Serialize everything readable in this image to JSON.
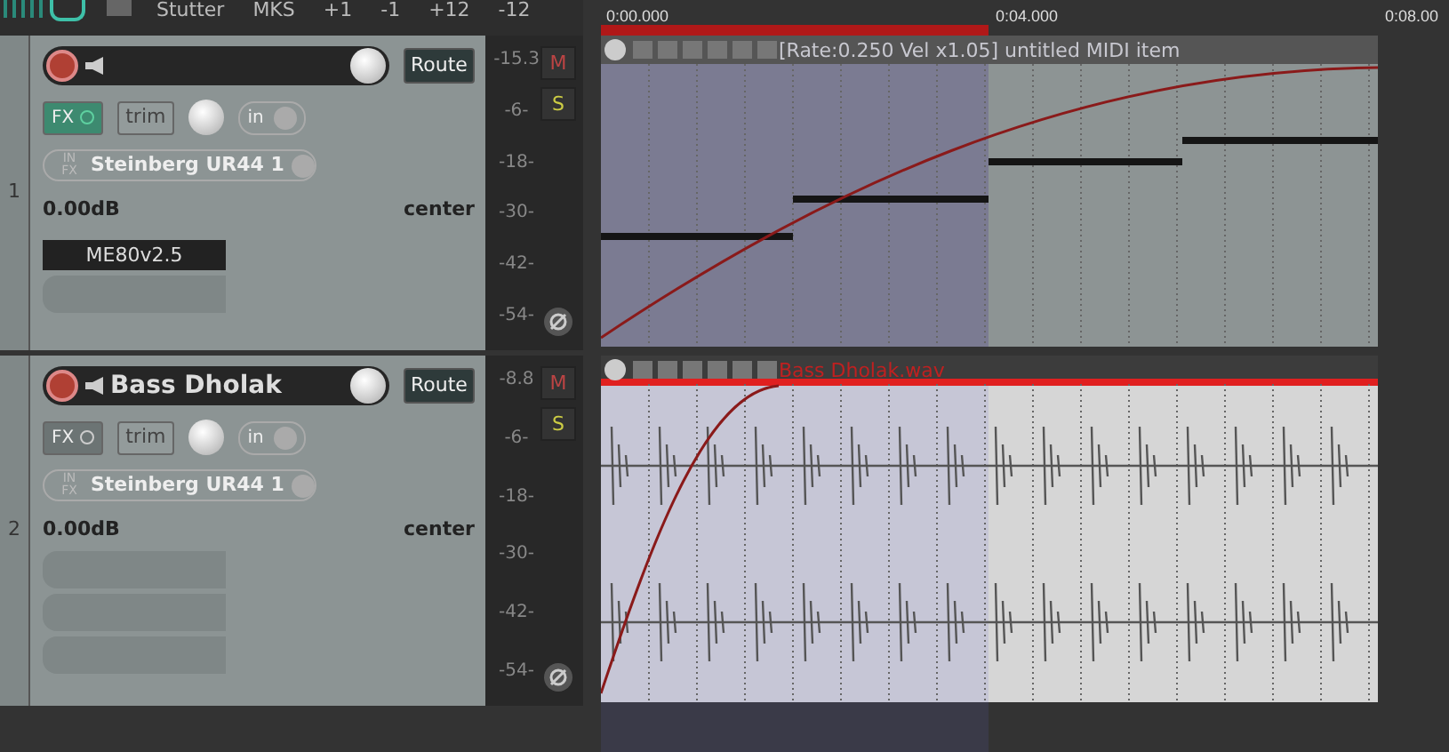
{
  "toolbar": {
    "buttons": [
      "Stutter",
      "MKS",
      "+1",
      "-1",
      "+12",
      "-12"
    ]
  },
  "ruler": {
    "times": [
      "0:00.000",
      "0:04.000",
      "0:08.00"
    ]
  },
  "tracks": [
    {
      "number": "1",
      "record_armed": true,
      "fx_active": true,
      "route": "Route",
      "fx_label": "FX",
      "trim": "trim",
      "input_mode": "in",
      "input_badge": "IN FX",
      "input": "Steinberg UR44 1",
      "volume": "0.00dB",
      "pan": "center",
      "meter_peak": "-15.3",
      "meter_ticks": [
        "-6-",
        "-18-",
        "-30-",
        "-42-",
        "-54-"
      ],
      "mute": "M",
      "solo": "S",
      "fx_slots": [
        {
          "kind": "plugin",
          "name": "ME80v2.5"
        },
        {
          "kind": "empty"
        }
      ],
      "item": {
        "kind": "midi",
        "label": "[Rate:0.250 Vel x1.05] untitled MIDI item",
        "selected": false
      }
    },
    {
      "number": "2",
      "name": "Bass Dholak",
      "record_armed": true,
      "fx_active": false,
      "route": "Route",
      "fx_label": "FX",
      "trim": "trim",
      "input_mode": "in",
      "input_badge": "IN FX",
      "input": "Steinberg UR44 1",
      "volume": "0.00dB",
      "pan": "center",
      "meter_peak": "-8.8",
      "meter_ticks": [
        "-6-",
        "-18-",
        "-30-",
        "-42-",
        "-54-"
      ],
      "mute": "M",
      "solo": "S",
      "fx_slots": [
        {
          "kind": "empty"
        },
        {
          "kind": "empty"
        },
        {
          "kind": "empty"
        }
      ],
      "item": {
        "kind": "audio",
        "label": "Bass Dholak.wav",
        "selected": true
      }
    }
  ]
}
